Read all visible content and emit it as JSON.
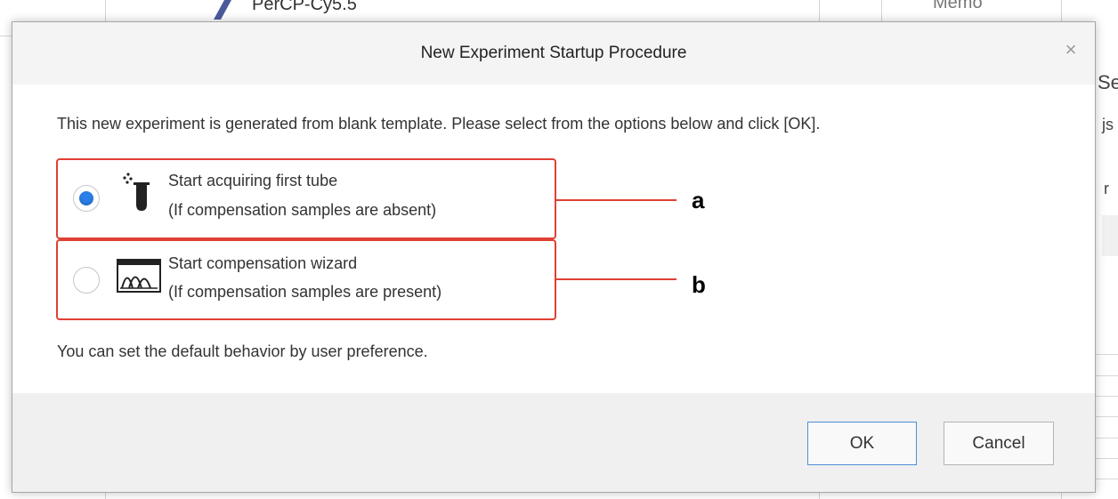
{
  "background": {
    "top_text": "PerCP-Cy5.5",
    "top_right_text": "Memo",
    "right_fragment_1": "Se",
    "right_fragment_2": "js",
    "right_fragment_3": "r"
  },
  "dialog": {
    "title": "New Experiment Startup Procedure",
    "close_glyph": "×",
    "instruction": "This new experiment is generated from blank template. Please select from the options below and click [OK].",
    "options": [
      {
        "line1": "Start acquiring first tube",
        "line2": "(If compensation samples are absent)",
        "selected": true,
        "icon": "test-tube-icon",
        "callout": "a"
      },
      {
        "line1": "Start compensation wizard",
        "line2": "(If compensation samples are present)",
        "selected": false,
        "icon": "compensation-peaks-icon",
        "callout": "b"
      }
    ],
    "footer_note": "You can set the default behavior by user preference.",
    "ok_label": "OK",
    "cancel_label": "Cancel"
  },
  "colors": {
    "highlight_border": "#e04034",
    "radio_selected": "#2a7ee8",
    "ok_border": "#4e8ed6"
  }
}
